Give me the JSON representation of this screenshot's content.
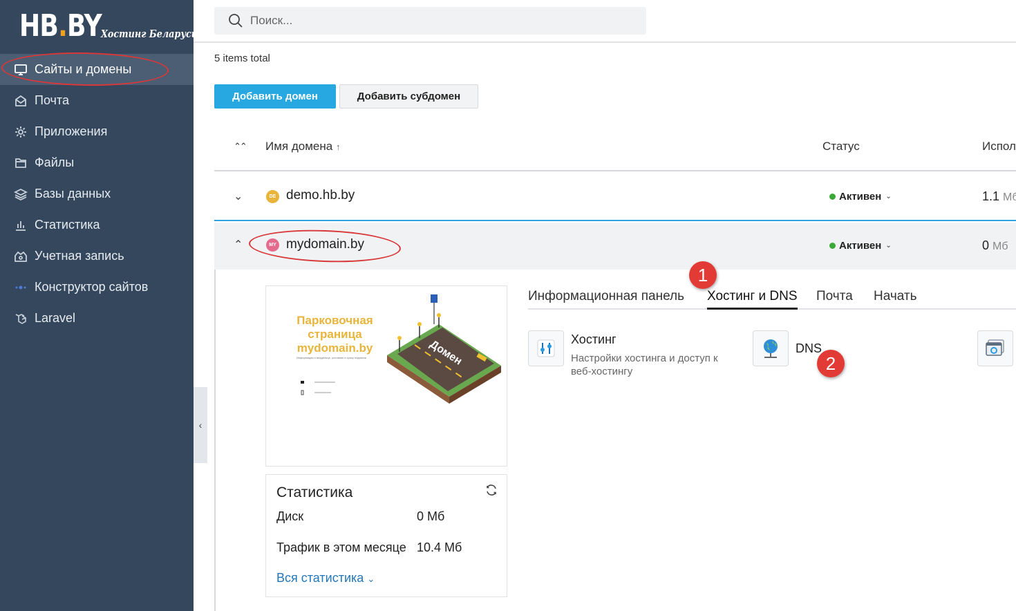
{
  "logo": {
    "main_before": "HB",
    "main_dot": ".",
    "main_after": "BY",
    "sub": "Хостинг Беларуси"
  },
  "sidebar": {
    "items": [
      {
        "label": "Сайты и домены",
        "icon": "monitor-icon"
      },
      {
        "label": "Почта",
        "icon": "mail-icon"
      },
      {
        "label": "Приложения",
        "icon": "gear-icon"
      },
      {
        "label": "Файлы",
        "icon": "folder-icon"
      },
      {
        "label": "Базы данных",
        "icon": "database-icon"
      },
      {
        "label": "Статистика",
        "icon": "bar-chart-icon"
      },
      {
        "label": "Учетная запись",
        "icon": "account-icon"
      },
      {
        "label": "Конструктор сайтов",
        "icon": "builder-icon"
      },
      {
        "label": "Laravel",
        "icon": "laravel-icon"
      }
    ],
    "collapse_glyph": "‹"
  },
  "search": {
    "placeholder": "Поиск..."
  },
  "list": {
    "total": "5 items total",
    "add_domain": "Добавить домен",
    "add_subdomain": "Добавить субдомен"
  },
  "table": {
    "sort_glyph": "⌃⌃",
    "col_name": "Имя домена",
    "col_name_arrow": "↑",
    "col_status": "Статус",
    "col_usage": "Испол",
    "rows": [
      {
        "chevron": "⌄",
        "badge": "DE",
        "badge_color": "#e8b43a",
        "domain": "demo.hb.by",
        "status": "Активен",
        "usage_value": "1.1",
        "usage_unit": "Мб"
      },
      {
        "chevron": "⌃",
        "badge": "MY",
        "badge_color": "#e46b8d",
        "domain": "mydomain.by",
        "status": "Активен",
        "usage_value": "0",
        "usage_unit": "Мб"
      }
    ]
  },
  "preview": {
    "title": "Парковочная страница mydomain.by",
    "subtitle": "Информация о владельце, условиях и сроку подписки",
    "sign_text": "Домен"
  },
  "stats": {
    "title": "Статистика",
    "disk_label": "Диск",
    "disk_value": "0 Мб",
    "traffic_label": "Трафик в этом месяце",
    "traffic_value": "10.4 Мб",
    "link": "Вся статистика",
    "link_caret": "⌄"
  },
  "tabs": [
    "Информационная панель",
    "Хостинг и DNS",
    "Почта",
    "Начать"
  ],
  "active_tab": "Хостинг и DNS",
  "tools": [
    {
      "title": "Хостинг",
      "desc": "Настройки хостинга и доступ к веб-хостингу",
      "icon": "hosting-settings-icon"
    },
    {
      "title": "DNS",
      "desc": "",
      "icon": "globe-dns-icon"
    },
    {
      "title": "",
      "desc": "",
      "icon": "window-settings-icon"
    }
  ],
  "markers": [
    "1",
    "2"
  ],
  "colors": {
    "sidebar_bg": "#35475c",
    "sidebar_active": "#4c5e73",
    "primary": "#28a8e0",
    "status_active": "#3ba935",
    "annotation_red": "#e23b35"
  }
}
